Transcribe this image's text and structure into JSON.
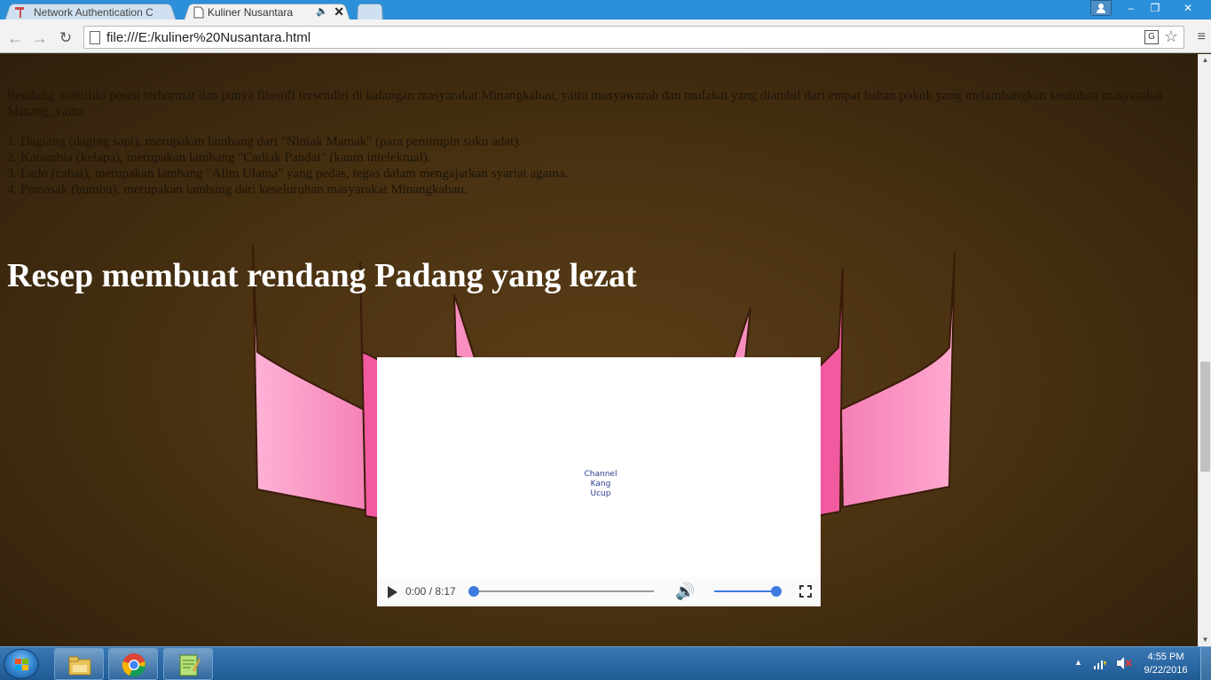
{
  "browser": {
    "tabs": [
      {
        "label": "Network Authentication C",
        "active": false
      },
      {
        "label": "Kuliner Nusantara",
        "active": true,
        "audio_icon": "🔈",
        "close": "✕"
      }
    ],
    "address": "file:///E:/kuliner%20Nusantara.html",
    "icons": {
      "back": "←",
      "forward": "→",
      "reload": "↻",
      "star": "☆",
      "menu": "≡"
    },
    "window_controls": {
      "minimize": "–",
      "maximize": "❐",
      "close": "✕"
    }
  },
  "page": {
    "intro": "Rendang memiliki posisi terhormat dan punya filosofi tersendiri di kalangan masyarakat Minangkabau, yaitu musyawarah dan mufakat yang diambil dari empat bahan pokok yang melambangkan keutuhan masyarakat Minang, yaitu:",
    "list": [
      "1. Dagiang (daging sapi), merupakan lambang dari \"Niniak Mamak\" (para pemimpin suku adat).",
      "2. Karambia (kelapa), merupakan lambang \"Cadiak Pandai\" (kaum intelektual).",
      "3. Lado (cabai), merupakan lambang \"Alim Ulama\" yang pedas, tegas dalam mengajarkan syariat agama.",
      "4. Pemasak (bumbu), merupakan lambang dari keseluruhan masyarakat Minangkabau."
    ],
    "heading": "Resep membuat rendang Padang yang lezat",
    "video": {
      "watermark_line1": "Channel",
      "watermark_line2": "Kang Ucup",
      "time": "0:00 / 8:17",
      "progress": 0,
      "volume": 1.0
    },
    "colors": {
      "background": "#4a3212",
      "roof_pink": "#f98fc0",
      "roof_deep": "#f25aa0",
      "heading": "#ffffff",
      "accent": "#3d7be0"
    }
  },
  "taskbar": {
    "time": "4:55 PM",
    "date": "9/22/2016",
    "tray_up": "▲"
  }
}
